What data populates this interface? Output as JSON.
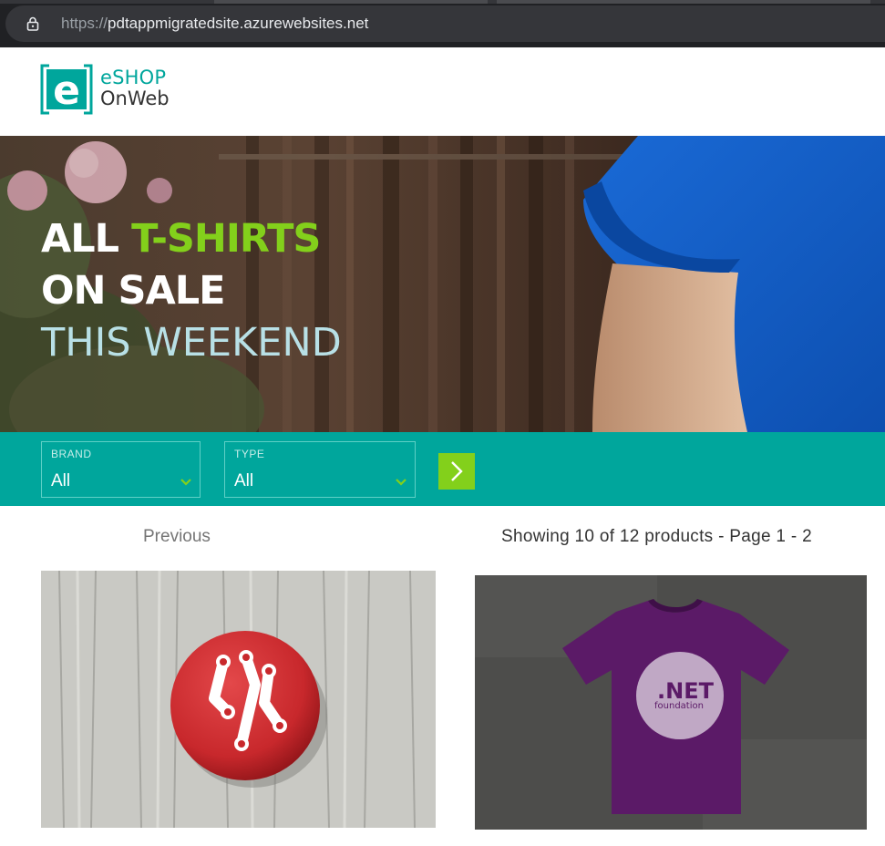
{
  "browser": {
    "url_scheme": "https://",
    "url_host": "pdtappmigratedsite.azurewebsites.net",
    "icons": {
      "lock": "lock-icon"
    }
  },
  "header": {
    "logo_line1": "eSHOP",
    "logo_line2": "OnWeb",
    "logo_mark": "e"
  },
  "hero": {
    "line1_white": "ALL",
    "line1_green": "T-SHIRTS",
    "line2": "ON SALE",
    "line3": "THIS WEEKEND"
  },
  "filters": {
    "brand": {
      "label": "BRAND",
      "value": "All"
    },
    "type": {
      "label": "TYPE",
      "value": "All"
    },
    "apply_icon": "chevron-right-icon"
  },
  "pager": {
    "previous_label": "Previous",
    "info": "Showing 10 of 12 products - Page 1 - 2"
  },
  "products": [
    {
      "image_icon": "red-pin-badge-image"
    },
    {
      "image_icon": "purple-tshirt-image",
      "image_text_1": ".NET",
      "image_text_2": "foundation"
    }
  ],
  "colors": {
    "teal": "#00a69c",
    "lime": "#83d01b",
    "hero_light_text": "#b8e0e6",
    "browser_bg": "#202124"
  }
}
